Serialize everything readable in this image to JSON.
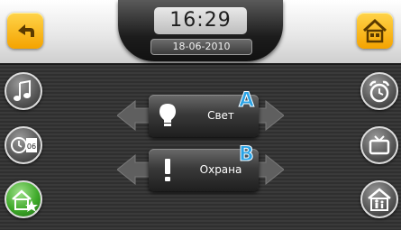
{
  "clock": {
    "time": "16:29",
    "date": "18-06-2010"
  },
  "top": {
    "back_icon": "back-arrow-icon",
    "home_icon": "home-icon"
  },
  "left_buttons": [
    {
      "icon": "music-note-icon"
    },
    {
      "icon": "clock-calendar-icon",
      "day": "06"
    },
    {
      "icon": "home-star-icon",
      "active": true
    }
  ],
  "right_buttons": [
    {
      "icon": "alarm-clock-icon"
    },
    {
      "icon": "tv-icon"
    },
    {
      "icon": "house-family-icon"
    }
  ],
  "menu": [
    {
      "label": "Свет",
      "icon": "lightbulb-icon",
      "badge": "A"
    },
    {
      "label": "Охрана",
      "icon": "exclamation-icon",
      "badge": "B"
    }
  ],
  "colors": {
    "accent_yellow": "#f4a300",
    "active_green": "#3faa2a",
    "badge_blue": "#29a3e6"
  }
}
